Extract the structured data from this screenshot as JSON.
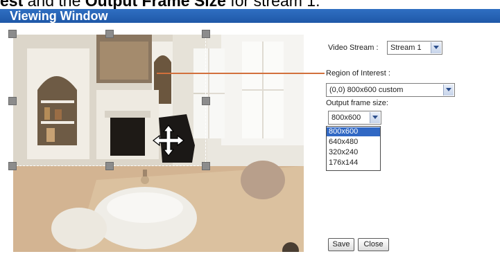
{
  "caption": {
    "part1": "est",
    "part2": "and the",
    "part3": "Output Frame Size",
    "part4": "for stream 1."
  },
  "header": {
    "title": "Viewing Window"
  },
  "viewport": {
    "move_icon": "move-arrows-icon",
    "handle_color": "#8c8c8c",
    "leader_color": "#d2703c"
  },
  "form": {
    "video_stream_label": "Video Stream :",
    "video_stream_value": "Stream 1",
    "roi_label": "Region of Interest :",
    "roi_value": "(0,0) 800x600 custom",
    "frame_size_label": "Output frame size:",
    "frame_size_value": "800x600",
    "frame_size_options": [
      "800x600",
      "640x480",
      "320x240",
      "176x144"
    ],
    "frame_size_highlighted": "800x600"
  },
  "buttons": {
    "save": "Save",
    "close": "Close"
  },
  "colors": {
    "header_bar": "#2462b6",
    "selection": "#3168c4"
  }
}
